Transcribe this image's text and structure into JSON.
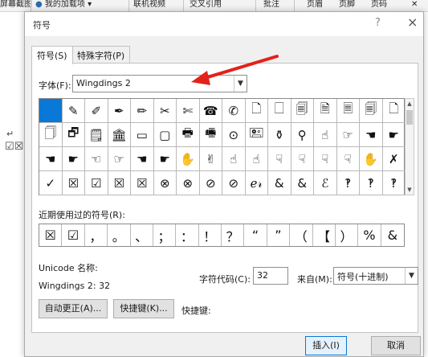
{
  "ribbon": {
    "items": [
      "屏幕截图",
      "我的加载项",
      "联机视频",
      "交叉引用",
      "批注",
      "页眉",
      "页脚",
      "页码"
    ]
  },
  "dialog": {
    "title": "符号",
    "help": "?",
    "close": "×",
    "tabs": [
      "符号(S)",
      "特殊字符(P)"
    ],
    "font_label": "字体(F):",
    "font_value": "Wingdings 2",
    "symbols": [
      "",
      "✎",
      "✐",
      "✒",
      "✏",
      "✂",
      "✄",
      "☎",
      "✆",
      "🗋",
      "🗌",
      "🗐",
      "🗎",
      "🗏",
      "🗐",
      "🗋",
      "🗍",
      "🗗",
      "🗒",
      "🏛",
      "▭",
      "▢",
      "🖶",
      "🖷",
      "⊙",
      "🖭",
      "⚱",
      "⚲",
      "☝",
      "☞",
      "☚",
      "☛",
      "☚",
      "☛",
      "☜",
      "☞",
      "☚",
      "☛",
      "✋",
      "✌",
      "☝",
      "☝",
      "☟",
      "☟",
      "☟",
      "☟",
      "✋",
      "✗",
      "✓",
      "☒",
      "☑",
      "☒",
      "☒",
      "⊗",
      "⊗",
      "⊘",
      "⊘",
      "ℯ𝓇",
      "&",
      "&",
      "ℰ",
      "‽",
      "‽",
      "‽"
    ],
    "recent_label": "近期使用过的符号(R):",
    "recent_symbols": [
      "☒",
      "☑",
      "，",
      "。",
      "、",
      "；",
      "：",
      "！",
      "？",
      "“",
      "”",
      "（",
      "【",
      "）",
      "%",
      "&"
    ],
    "unicode_label": "Unicode 名称:",
    "wingdings_value": "Wingdings 2: 32",
    "char_code_label": "字符代码(C):",
    "char_code_value": "32",
    "from_label": "来自(M):",
    "from_value": "符号(十进制)",
    "autocorrect_button": "自动更正(A)...",
    "shortcut_button": "快捷键(K)...",
    "shortcut_label": "快捷键:",
    "insert_button": "插入(I)",
    "cancel_button": "取消"
  },
  "colors": {
    "selection": "#0a78d7",
    "arrow": "#e2231a",
    "dialog_bg": "#f0f0f0"
  }
}
